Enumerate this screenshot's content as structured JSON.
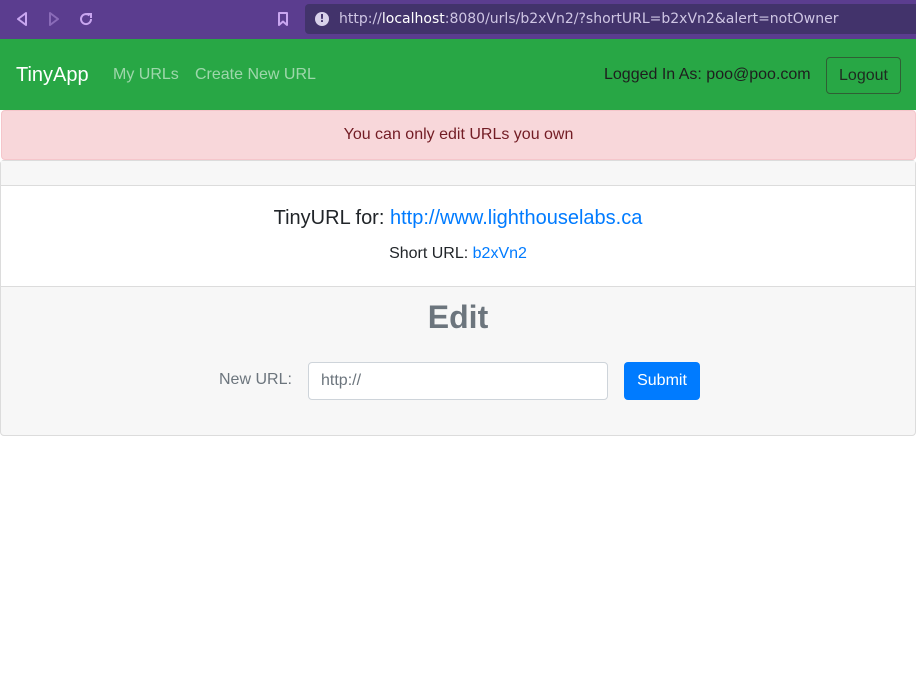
{
  "browser": {
    "url_prefix": "http://",
    "url_host": "localhost",
    "url_rest": ":8080/urls/b2xVn2/?shortURL=b2xVn2&alert=notOwner",
    "icons": [
      "back-icon",
      "forward-icon",
      "reload-icon",
      "bookmark-icon",
      "info-icon"
    ]
  },
  "navbar": {
    "brand": "TinyApp",
    "links": [
      "My URLs",
      "Create New URL"
    ],
    "logged_in_text": "Logged In As: poo@poo.com",
    "logout_label": "Logout"
  },
  "alert": {
    "message": "You can only edit URLs you own"
  },
  "url_info": {
    "tiny_label": "TinyURL for:",
    "long_url": "http://www.lighthouselabs.ca",
    "short_label": "Short URL:",
    "short_url": "b2xVn2"
  },
  "edit": {
    "title": "Edit",
    "field_label": "New URL:",
    "field_value": "",
    "field_placeholder": "http://",
    "submit_label": "Submit"
  },
  "colors": {
    "navbar": "#28a745",
    "alert_bg": "#f8d7da",
    "link": "#007bff",
    "browser_chrome": "#5b3d8f"
  }
}
